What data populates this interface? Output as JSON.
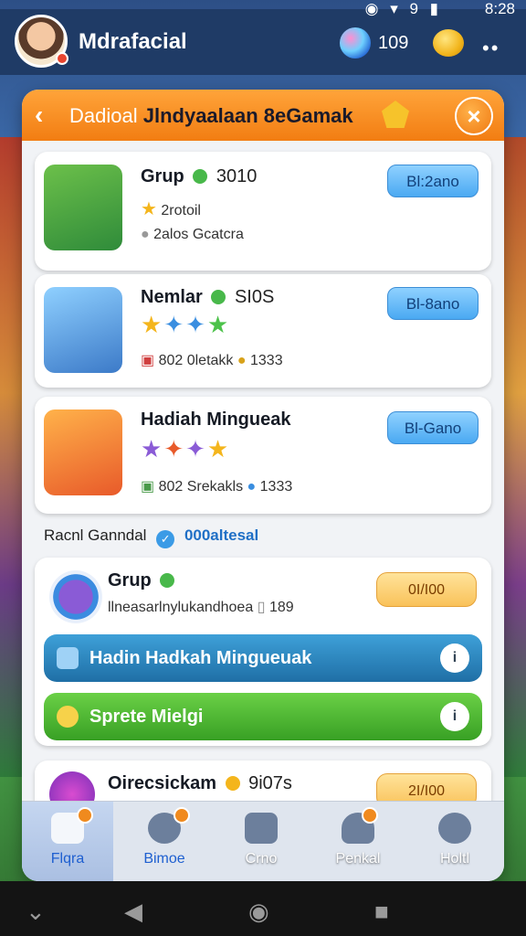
{
  "status_bar": {
    "time": "8:28",
    "icons": "◉ ▾ 9 ▮"
  },
  "header": {
    "app_title": "Mdrafacial",
    "gems": "109"
  },
  "dialog": {
    "title_part1": "Dadioal",
    "title_part2": "Jlndyaalaan 8eGamak",
    "cards": [
      {
        "title": "Grup",
        "count": "3010",
        "line2": "2rotoil",
        "line3": "2alos Gcatcra",
        "button": "Bl:2ano"
      },
      {
        "title": "Nemlar",
        "count": "SI0S",
        "line2": "",
        "line3": "802 0letakk",
        "line3_count": "1333",
        "button": "Bl-8ano"
      },
      {
        "title": "Hadiah Mingueak",
        "count": "",
        "line2": "",
        "line3": "802 Srekakls",
        "line3_count": "1333",
        "button": "Bl-Gano"
      }
    ],
    "section": {
      "label": "Racnl Ganndal",
      "link": "000altesal"
    },
    "group_card": {
      "title": "Grup",
      "subtitle": "llneasarlnylukandhoea",
      "count": "189",
      "pill": "0I/I00",
      "bar_blue": "Hadin Hadkah Mingueuak",
      "bar_green": "Sprete Mielgi"
    },
    "bottom_card": {
      "title": "Oirecsickam",
      "count": "9i07s",
      "pill": "2I/I00"
    }
  },
  "bottom_nav": [
    {
      "label": "Flqra"
    },
    {
      "label": "Bimoe"
    },
    {
      "label": "Crno"
    },
    {
      "label": "Penkal"
    },
    {
      "label": "Holtl"
    }
  ],
  "colors": {
    "accent": "#f27d12",
    "header": "#1f3b66",
    "link": "#1f6fc6"
  }
}
